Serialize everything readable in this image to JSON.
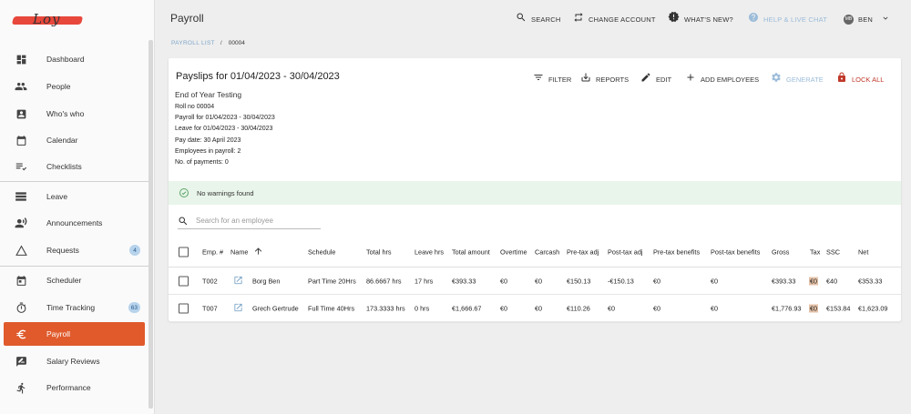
{
  "app": {
    "logo_text": "Loy",
    "page_title": "Payroll"
  },
  "topbar": {
    "search": "SEARCH",
    "change_account": "CHANGE ACCOUNT",
    "whats_new": "WHAT'S NEW?",
    "help": "HELP & LIVE CHAT",
    "user_initials": "MB",
    "user_name": "BEN"
  },
  "sidebar": {
    "items": [
      {
        "label": "Dashboard"
      },
      {
        "label": "People"
      },
      {
        "label": "Who's who"
      },
      {
        "label": "Calendar"
      },
      {
        "label": "Checklists"
      },
      {
        "label": "Leave"
      },
      {
        "label": "Announcements"
      },
      {
        "label": "Requests",
        "badge": "4"
      },
      {
        "label": "Scheduler"
      },
      {
        "label": "Time Tracking",
        "badge": "63"
      },
      {
        "label": "Payroll"
      },
      {
        "label": "Salary Reviews"
      },
      {
        "label": "Performance"
      }
    ]
  },
  "breadcrumb": {
    "link": "PAYROLL LIST",
    "separator": "/",
    "current": "00004"
  },
  "card": {
    "title": "Payslips for 01/04/2023 - 30/04/2023",
    "actions": {
      "filter": "FILTER",
      "reports": "REPORTS",
      "edit": "EDIT",
      "add_employees": "ADD EMPLOYEES",
      "generate": "GENERATE",
      "lock_all": "LOCK ALL"
    },
    "subtitle": "End of Year Testing",
    "info": [
      "Roll no 00004",
      "Payroll for 01/04/2023 - 30/04/2023",
      "Leave for 01/04/2023 - 30/04/2023",
      "Pay date: 30 April 2023",
      "Employees in payroll: 2",
      "No. of payments: 0"
    ],
    "warning": "No warnings found",
    "search_placeholder": "Search for an employee"
  },
  "table": {
    "columns": [
      "Emp. #",
      "Name",
      "Schedule",
      "Total hrs",
      "Leave hrs",
      "Total amount",
      "Overtime",
      "Carcash",
      "Pre-tax adj",
      "Post-tax adj",
      "Pre-tax benefits",
      "Post-tax benefits",
      "Gross",
      "Tax",
      "SSC",
      "Net"
    ],
    "rows": [
      [
        "T002",
        "Borg Ben",
        "Part Time 20Hrs",
        "86.6667 hrs",
        "17 hrs",
        "€393.33",
        "€0",
        "€0",
        "€150.13",
        "-€150.13",
        "€0",
        "€0",
        "€393.33",
        "€0",
        "€40",
        "€353.33"
      ],
      [
        "T007",
        "Grech Gertrude",
        "Full Time 40Hrs",
        "173.3333 hrs",
        "0 hrs",
        "€1,666.67",
        "€0",
        "€0",
        "€110.26",
        "€0",
        "€0",
        "€0",
        "€1,776.93",
        "€0",
        "€153.84",
        "€1,623.09"
      ]
    ]
  },
  "colors": {
    "accent": "#e05a2c",
    "badge": "#b7d3ec",
    "lock": "#c0392b",
    "success_bg": "#e9f5ea"
  }
}
